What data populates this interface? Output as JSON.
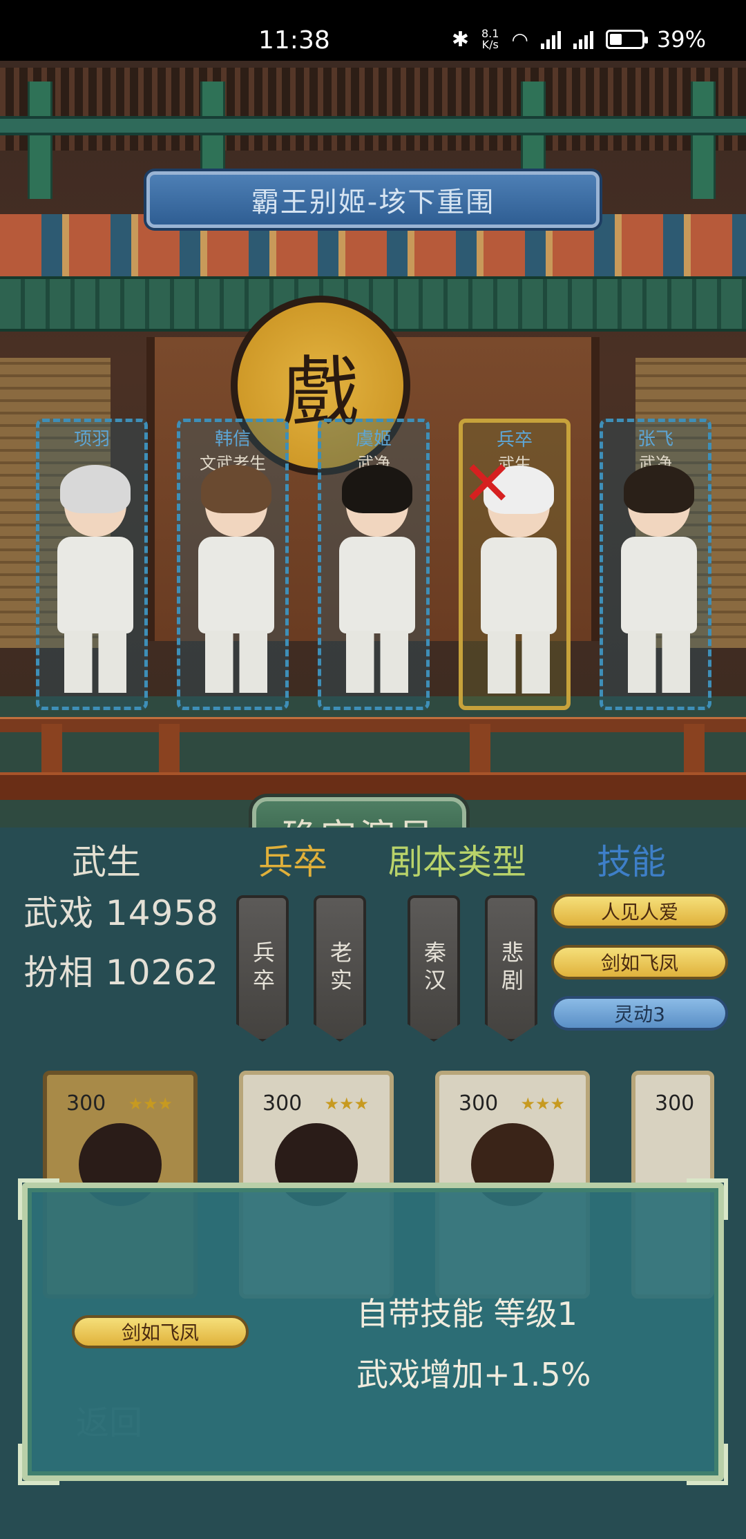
{
  "status_bar": {
    "time": "11:38",
    "speed_value": "8.1",
    "speed_unit": "K/s",
    "battery": "39%",
    "battery_level": 0.39
  },
  "stage": {
    "title": "霸王别姬-垓下重围",
    "sign_char": "戲",
    "actors": [
      {
        "name": "项羽",
        "role": ""
      },
      {
        "name": "韩信",
        "role": "文武老生"
      },
      {
        "name": "虞姬",
        "role": "武净"
      },
      {
        "name": "兵卒",
        "role": "武生"
      },
      {
        "name": "张飞",
        "role": "武净"
      }
    ],
    "confirm_label": "确定演员"
  },
  "info": {
    "role_header": "武生",
    "type_header": "兵卒",
    "script_header": "剧本类型",
    "skill_header": "技能",
    "stat1": "武戏 14958",
    "stat2": "扮相 10262",
    "tags": [
      "兵卒",
      "老实",
      "秦汉",
      "悲剧"
    ],
    "skills": [
      "人见人爱",
      "剑如飞凤",
      "灵动3"
    ]
  },
  "cards": [
    {
      "cost": "300",
      "stars": "★★★"
    },
    {
      "cost": "300",
      "stars": "★★★"
    },
    {
      "cost": "300",
      "stars": "★★★"
    },
    {
      "cost": "300",
      "stars": ""
    }
  ],
  "dialog": {
    "skill": "剑如飞凤",
    "line1": "自带技能 等级1",
    "line2": "武戏增加+1.5%"
  },
  "back_label": "返回",
  "colors": {
    "accent_gold": "#e0b23c",
    "actor_border": "#3e8fb8",
    "panel_bg": "#274c52"
  }
}
